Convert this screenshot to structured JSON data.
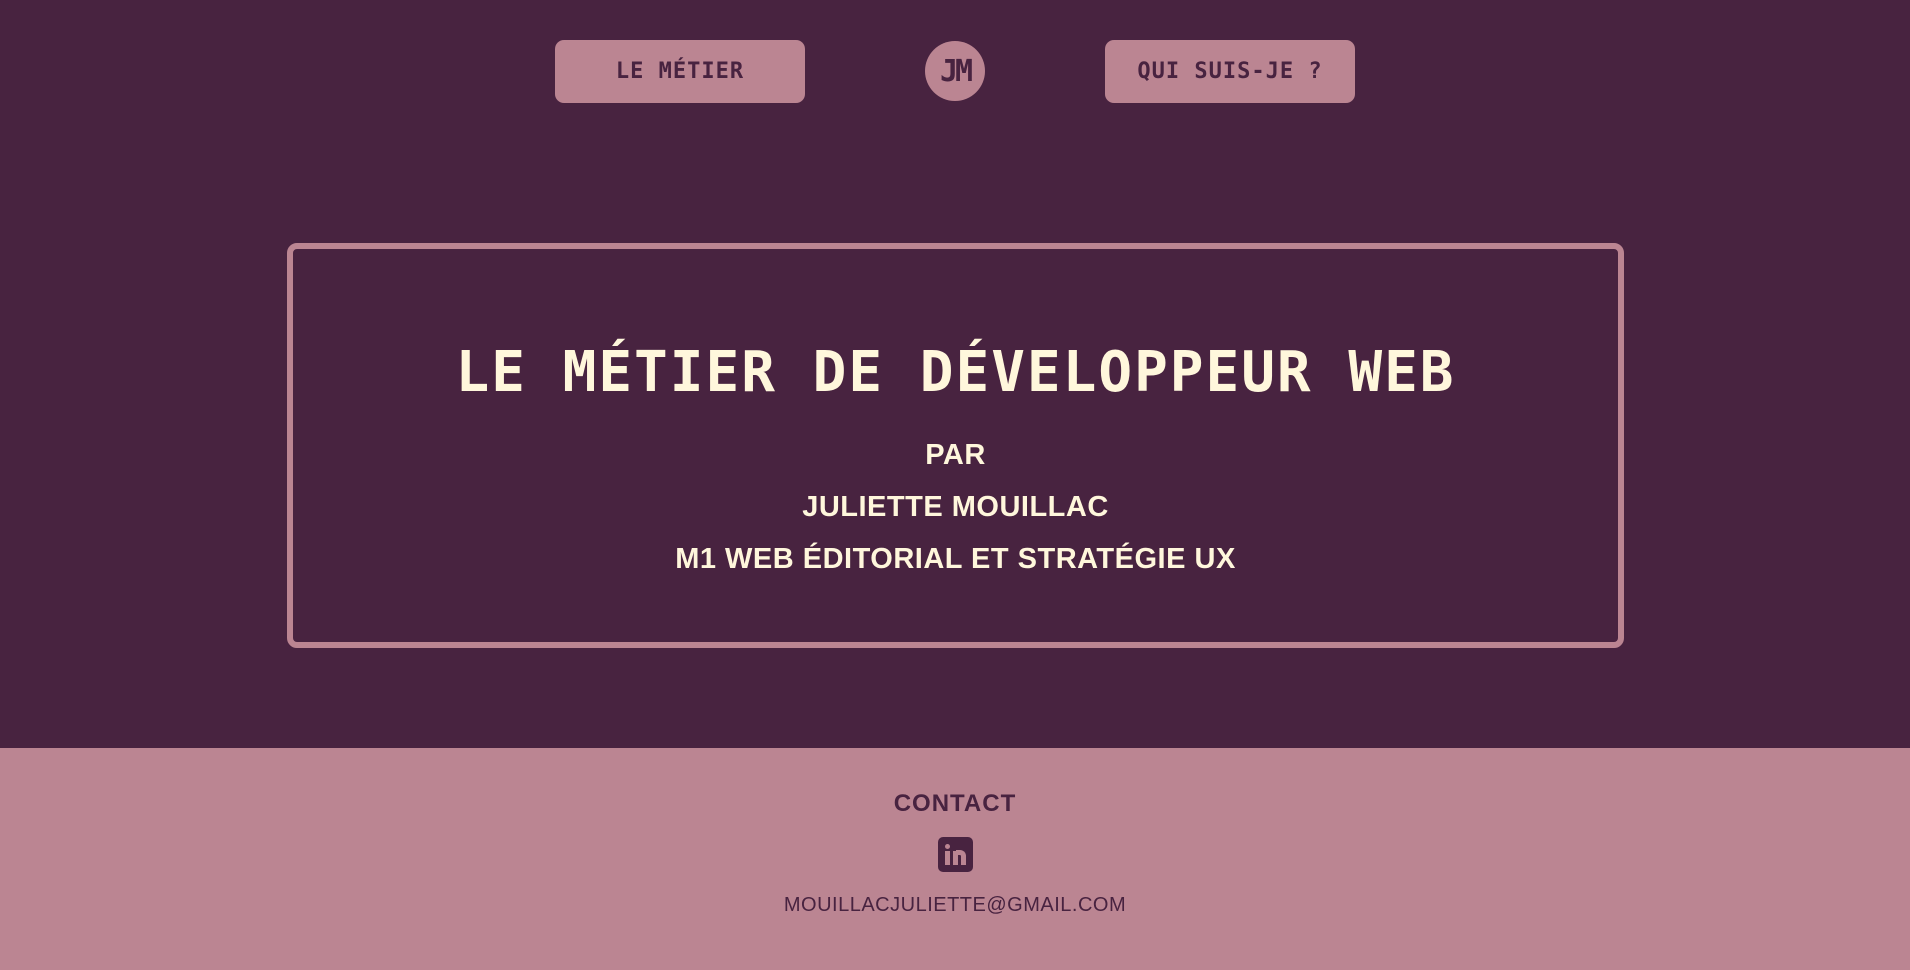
{
  "nav": {
    "left_label": "LE MÉTIER",
    "logo_text": "JM",
    "right_label": "QUI SUIS-JE ?"
  },
  "hero": {
    "title": "LE MÉTIER DE DÉVELOPPEUR WEB",
    "by": "PAR",
    "author": "JULIETTE MOUILLAC",
    "program": "M1 WEB ÉDITORIAL ET STRATÉGIE UX"
  },
  "footer": {
    "contact_title": "CONTACT",
    "linkedin_icon": "linkedin-icon",
    "email": "MOUILLACJULIETTE@GMAIL.COM"
  },
  "colors": {
    "background": "#482340",
    "accent": "#bb8592",
    "text_light": "#fff7dc"
  }
}
